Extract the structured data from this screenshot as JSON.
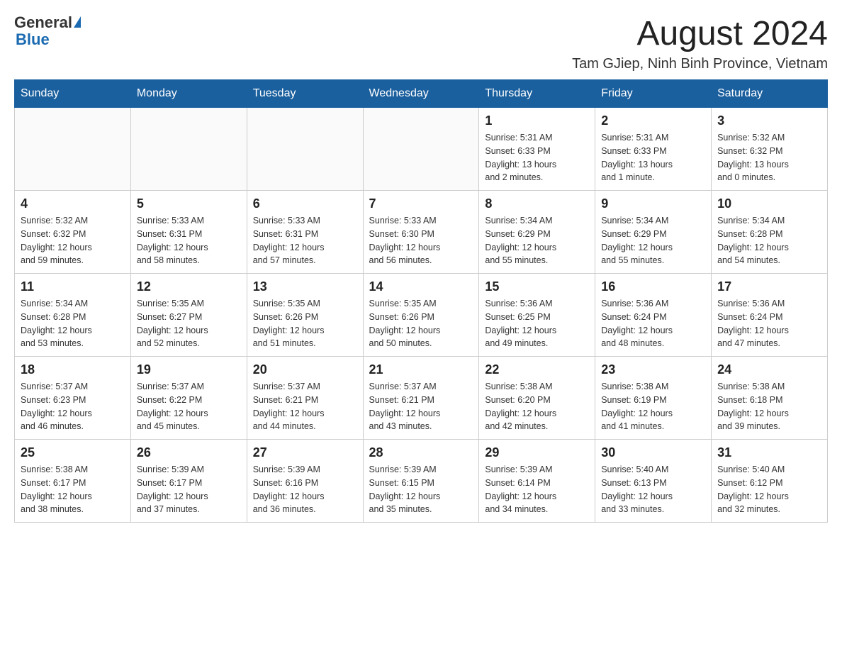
{
  "header": {
    "logo_general": "General",
    "logo_blue": "Blue",
    "month_title": "August 2024",
    "subtitle": "Tam GJiep, Ninh Binh Province, Vietnam"
  },
  "days_of_week": [
    "Sunday",
    "Monday",
    "Tuesday",
    "Wednesday",
    "Thursday",
    "Friday",
    "Saturday"
  ],
  "weeks": [
    [
      {
        "day": "",
        "info": ""
      },
      {
        "day": "",
        "info": ""
      },
      {
        "day": "",
        "info": ""
      },
      {
        "day": "",
        "info": ""
      },
      {
        "day": "1",
        "info": "Sunrise: 5:31 AM\nSunset: 6:33 PM\nDaylight: 13 hours\nand 2 minutes."
      },
      {
        "day": "2",
        "info": "Sunrise: 5:31 AM\nSunset: 6:33 PM\nDaylight: 13 hours\nand 1 minute."
      },
      {
        "day": "3",
        "info": "Sunrise: 5:32 AM\nSunset: 6:32 PM\nDaylight: 13 hours\nand 0 minutes."
      }
    ],
    [
      {
        "day": "4",
        "info": "Sunrise: 5:32 AM\nSunset: 6:32 PM\nDaylight: 12 hours\nand 59 minutes."
      },
      {
        "day": "5",
        "info": "Sunrise: 5:33 AM\nSunset: 6:31 PM\nDaylight: 12 hours\nand 58 minutes."
      },
      {
        "day": "6",
        "info": "Sunrise: 5:33 AM\nSunset: 6:31 PM\nDaylight: 12 hours\nand 57 minutes."
      },
      {
        "day": "7",
        "info": "Sunrise: 5:33 AM\nSunset: 6:30 PM\nDaylight: 12 hours\nand 56 minutes."
      },
      {
        "day": "8",
        "info": "Sunrise: 5:34 AM\nSunset: 6:29 PM\nDaylight: 12 hours\nand 55 minutes."
      },
      {
        "day": "9",
        "info": "Sunrise: 5:34 AM\nSunset: 6:29 PM\nDaylight: 12 hours\nand 55 minutes."
      },
      {
        "day": "10",
        "info": "Sunrise: 5:34 AM\nSunset: 6:28 PM\nDaylight: 12 hours\nand 54 minutes."
      }
    ],
    [
      {
        "day": "11",
        "info": "Sunrise: 5:34 AM\nSunset: 6:28 PM\nDaylight: 12 hours\nand 53 minutes."
      },
      {
        "day": "12",
        "info": "Sunrise: 5:35 AM\nSunset: 6:27 PM\nDaylight: 12 hours\nand 52 minutes."
      },
      {
        "day": "13",
        "info": "Sunrise: 5:35 AM\nSunset: 6:26 PM\nDaylight: 12 hours\nand 51 minutes."
      },
      {
        "day": "14",
        "info": "Sunrise: 5:35 AM\nSunset: 6:26 PM\nDaylight: 12 hours\nand 50 minutes."
      },
      {
        "day": "15",
        "info": "Sunrise: 5:36 AM\nSunset: 6:25 PM\nDaylight: 12 hours\nand 49 minutes."
      },
      {
        "day": "16",
        "info": "Sunrise: 5:36 AM\nSunset: 6:24 PM\nDaylight: 12 hours\nand 48 minutes."
      },
      {
        "day": "17",
        "info": "Sunrise: 5:36 AM\nSunset: 6:24 PM\nDaylight: 12 hours\nand 47 minutes."
      }
    ],
    [
      {
        "day": "18",
        "info": "Sunrise: 5:37 AM\nSunset: 6:23 PM\nDaylight: 12 hours\nand 46 minutes."
      },
      {
        "day": "19",
        "info": "Sunrise: 5:37 AM\nSunset: 6:22 PM\nDaylight: 12 hours\nand 45 minutes."
      },
      {
        "day": "20",
        "info": "Sunrise: 5:37 AM\nSunset: 6:21 PM\nDaylight: 12 hours\nand 44 minutes."
      },
      {
        "day": "21",
        "info": "Sunrise: 5:37 AM\nSunset: 6:21 PM\nDaylight: 12 hours\nand 43 minutes."
      },
      {
        "day": "22",
        "info": "Sunrise: 5:38 AM\nSunset: 6:20 PM\nDaylight: 12 hours\nand 42 minutes."
      },
      {
        "day": "23",
        "info": "Sunrise: 5:38 AM\nSunset: 6:19 PM\nDaylight: 12 hours\nand 41 minutes."
      },
      {
        "day": "24",
        "info": "Sunrise: 5:38 AM\nSunset: 6:18 PM\nDaylight: 12 hours\nand 39 minutes."
      }
    ],
    [
      {
        "day": "25",
        "info": "Sunrise: 5:38 AM\nSunset: 6:17 PM\nDaylight: 12 hours\nand 38 minutes."
      },
      {
        "day": "26",
        "info": "Sunrise: 5:39 AM\nSunset: 6:17 PM\nDaylight: 12 hours\nand 37 minutes."
      },
      {
        "day": "27",
        "info": "Sunrise: 5:39 AM\nSunset: 6:16 PM\nDaylight: 12 hours\nand 36 minutes."
      },
      {
        "day": "28",
        "info": "Sunrise: 5:39 AM\nSunset: 6:15 PM\nDaylight: 12 hours\nand 35 minutes."
      },
      {
        "day": "29",
        "info": "Sunrise: 5:39 AM\nSunset: 6:14 PM\nDaylight: 12 hours\nand 34 minutes."
      },
      {
        "day": "30",
        "info": "Sunrise: 5:40 AM\nSunset: 6:13 PM\nDaylight: 12 hours\nand 33 minutes."
      },
      {
        "day": "31",
        "info": "Sunrise: 5:40 AM\nSunset: 6:12 PM\nDaylight: 12 hours\nand 32 minutes."
      }
    ]
  ]
}
